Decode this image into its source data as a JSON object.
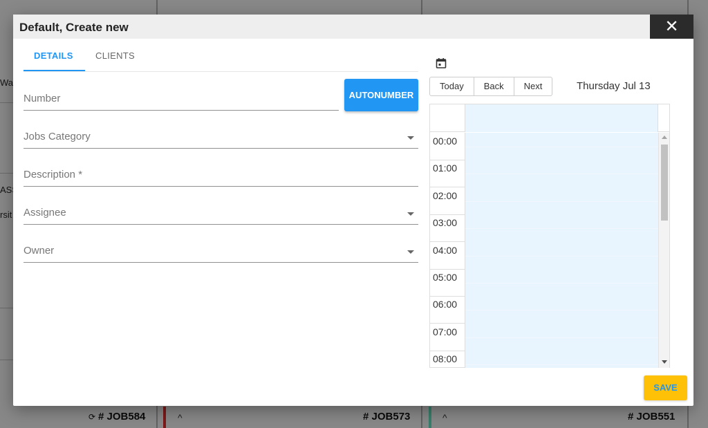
{
  "modal": {
    "title": "Default, Create new",
    "close_glyph": "✕",
    "tabs": [
      {
        "label": "DETAILS",
        "active": true
      },
      {
        "label": "CLIENTS",
        "active": false
      }
    ],
    "fields": {
      "number": {
        "label": "Number"
      },
      "jobs_category": {
        "label": "Jobs Category"
      },
      "description": {
        "label": "Description *"
      },
      "assignee": {
        "label": "Assignee"
      },
      "owner": {
        "label": "Owner"
      }
    },
    "autonumber_label": "AUTONUMBER",
    "save_label": "SAVE"
  },
  "calendar": {
    "icon": "calendar-icon",
    "toolbar": {
      "today": "Today",
      "back": "Back",
      "next": "Next"
    },
    "date_label": "Thursday Jul 13",
    "times": [
      "00:00",
      "01:00",
      "02:00",
      "03:00",
      "04:00",
      "05:00",
      "06:00",
      "07:00",
      "08:00"
    ]
  },
  "background": {
    "jobs": [
      "# JOB584",
      "# JOB573",
      "# JOB551"
    ],
    "fragments": [
      "Wat",
      "ASS",
      "rsit"
    ],
    "sync_glyph": "⟳",
    "caret_glyph": "^"
  },
  "colors": {
    "accent": "#2196f3",
    "save_button": "#ffc107",
    "close_button": "#2b2b2b",
    "calendar_day": "#e8f4fe",
    "left_bar": "#c62828",
    "right_bar": "#5ac8a8"
  }
}
